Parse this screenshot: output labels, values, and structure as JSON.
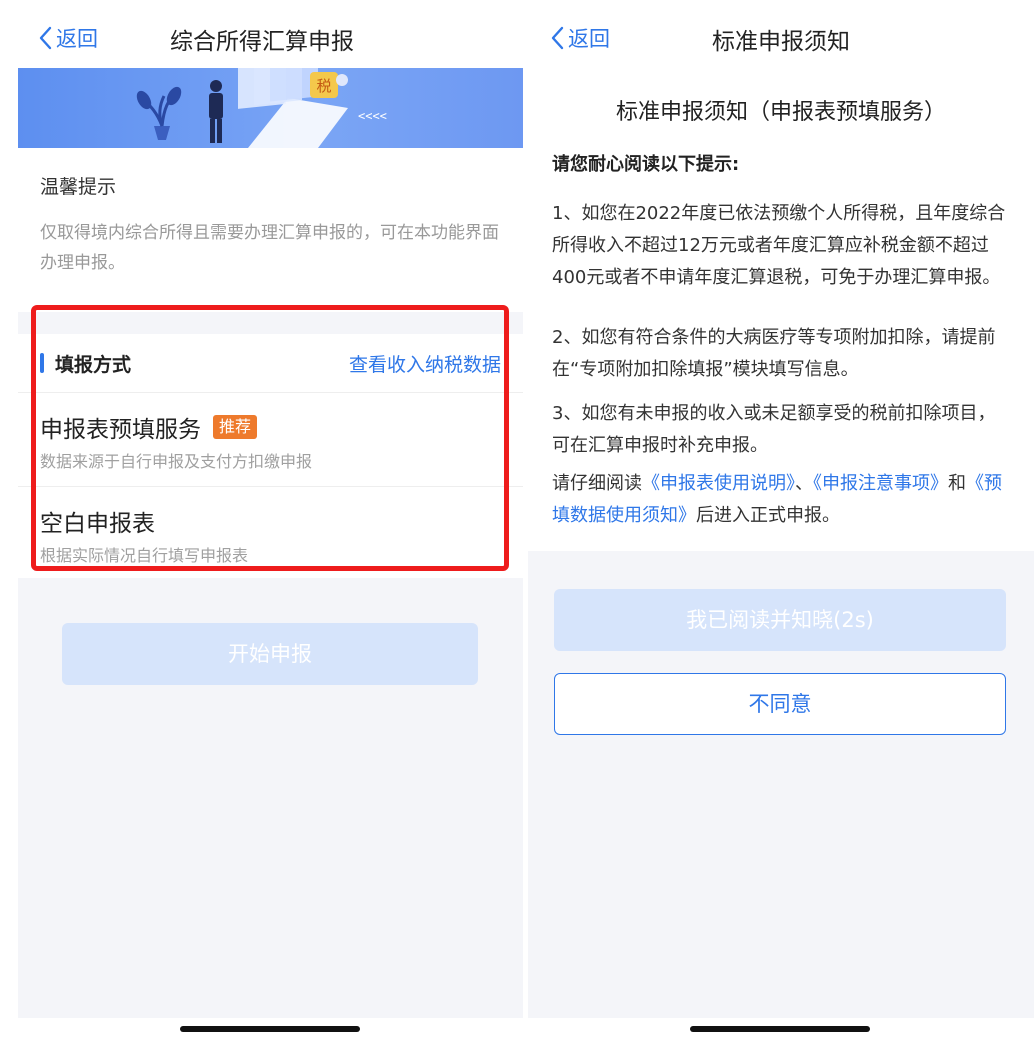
{
  "left": {
    "nav": {
      "back_label": "返回",
      "title": "综合所得汇算申报"
    },
    "banner": {
      "tax_char": "税",
      "arrows": "<<<<"
    },
    "tips": {
      "title": "温馨提示",
      "text": "仅取得境内综合所得且需要办理汇算申报的，可在本功能界面办理申报。"
    },
    "section": {
      "title": "填报方式",
      "link": "查看收入纳税数据",
      "options": [
        {
          "title": "申报表预填服务",
          "badge": "推荐",
          "subtitle": "数据来源于自行申报及支付方扣缴申报"
        },
        {
          "title": "空白申报表",
          "subtitle": "根据实际情况自行填写申报表"
        }
      ]
    },
    "start_button": "开始申报"
  },
  "right": {
    "nav": {
      "back_label": "返回",
      "title": "标准申报须知"
    },
    "heading": "标准申报须知（申报表预填服务）",
    "subheading": "请您耐心阅读以下提示:",
    "paragraphs": [
      "1、如您在2022年度已依法预缴个人所得税，且年度综合所得收入不超过12万元或者年度汇算应补税金额不超过400元或者不申请年度汇算退税，可免于办理汇算申报。",
      "2、如您有符合条件的大病医疗等专项附加扣除，请提前在“专项附加扣除填报”模块填写信息。",
      "3、如您有未申报的收入或未足额享受的税前扣除项目，可在汇算申报时补充申报。"
    ],
    "final": {
      "prefix": "请仔细阅读",
      "link1": "《申报表使用说明》",
      "sep": "、",
      "link2": "《申报注意事项》",
      "and": "和",
      "link3": "《预填数据使用须知》",
      "suffix": "后进入正式申报。"
    },
    "read_button": "我已阅读并知晓(2s)",
    "disagree_button": "不同意"
  },
  "colors": {
    "accent": "#2f77e8",
    "highlight_border": "#ee1c1c",
    "badge": "#ee7a2c",
    "disabled_button": "#d6e4fb",
    "background_gray": "#f4f5f9"
  }
}
